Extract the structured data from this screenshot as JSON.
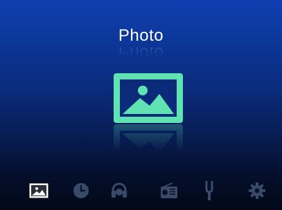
{
  "screen": {
    "title": "Photo",
    "main_icon": "photo-icon"
  },
  "colors": {
    "accent": "#5fe3b2",
    "background_top": "#0f3fb0",
    "background_bottom": "#020817",
    "dock_inactive": "#3a4a6a"
  },
  "dock": {
    "items": [
      {
        "icon": "photo-icon",
        "active": true
      },
      {
        "icon": "clock-icon",
        "active": false
      },
      {
        "icon": "headphones-icon",
        "active": false
      },
      {
        "icon": "radio-icon",
        "active": false
      },
      {
        "icon": "tuning-fork-icon",
        "active": false
      },
      {
        "icon": "gear-icon",
        "active": false
      }
    ]
  }
}
